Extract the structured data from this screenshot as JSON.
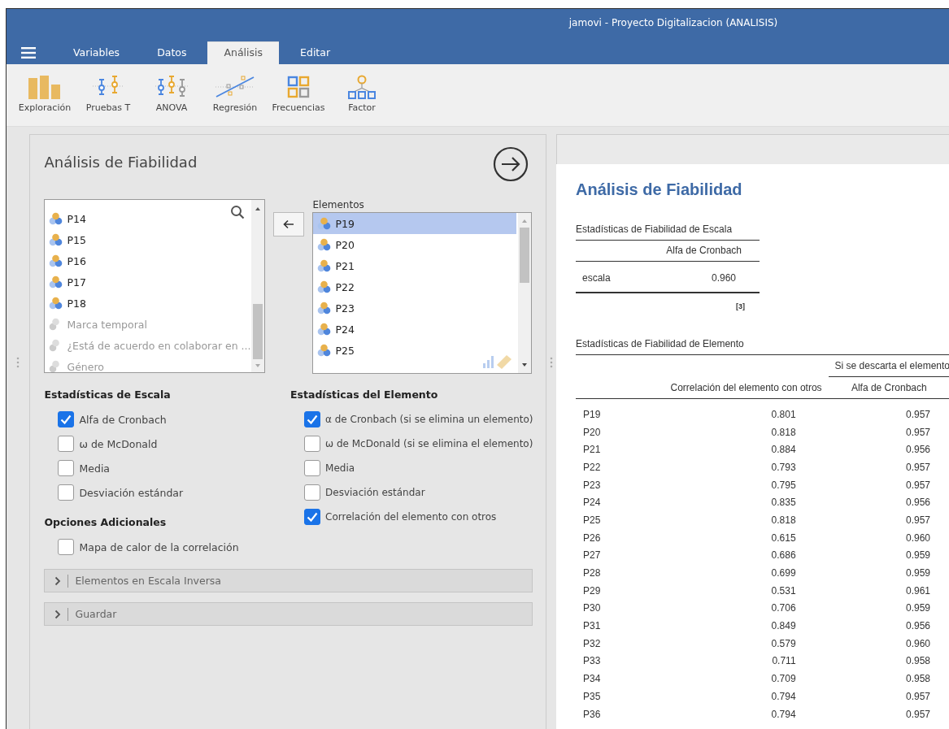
{
  "window": {
    "title": "jamovi - Proyecto Digitalizacion (ANALISIS)"
  },
  "tabs": [
    {
      "label": "Variables",
      "selected": false
    },
    {
      "label": "Datos",
      "selected": false
    },
    {
      "label": "Análisis",
      "selected": true
    },
    {
      "label": "Editar",
      "selected": false
    }
  ],
  "toolbar": [
    {
      "label": "Exploración",
      "kind": "bars"
    },
    {
      "label": "Pruebas T",
      "kind": "ttest"
    },
    {
      "label": "ANOVA",
      "kind": "anova"
    },
    {
      "label": "Regresión",
      "kind": "regression"
    },
    {
      "label": "Frecuencias",
      "kind": "grid"
    },
    {
      "label": "Factor",
      "kind": "tree"
    }
  ],
  "panel": {
    "title": "Análisis de Fiabilidad",
    "variables": [
      {
        "name": "P14",
        "disabled": false
      },
      {
        "name": "P15",
        "disabled": false
      },
      {
        "name": "P16",
        "disabled": false
      },
      {
        "name": "P17",
        "disabled": false
      },
      {
        "name": "P18",
        "disabled": false
      },
      {
        "name": "Marca temporal",
        "disabled": true
      },
      {
        "name": "¿Está de acuerdo en colaborar en ...",
        "disabled": true
      },
      {
        "name": "Género",
        "disabled": true
      }
    ],
    "target": {
      "label": "Elementos",
      "items": [
        {
          "name": "P19",
          "selected": true
        },
        {
          "name": "P20",
          "selected": false
        },
        {
          "name": "P21",
          "selected": false
        },
        {
          "name": "P22",
          "selected": false
        },
        {
          "name": "P23",
          "selected": false
        },
        {
          "name": "P24",
          "selected": false
        },
        {
          "name": "P25",
          "selected": false
        }
      ]
    },
    "scale_stats": {
      "heading": "Estadísticas de Escala",
      "options": [
        {
          "label": "Alfa de Cronbach",
          "checked": true
        },
        {
          "label": "ω de McDonald",
          "checked": false
        },
        {
          "label": "Media",
          "checked": false
        },
        {
          "label": "Desviación estándar",
          "checked": false
        }
      ]
    },
    "additional": {
      "heading": "Opciones Adicionales",
      "options": [
        {
          "label": "Mapa de calor de la correlación",
          "checked": false
        }
      ]
    },
    "item_stats": {
      "heading": "Estadísticas del Elemento",
      "options": [
        {
          "label": "α de Cronbach (si se elimina un elemento)",
          "checked": true
        },
        {
          "label": "ω de McDonald (si se elimina el elemento)",
          "checked": false
        },
        {
          "label": "Media",
          "checked": false
        },
        {
          "label": "Desviación estándar",
          "checked": false
        },
        {
          "label": "Correlación del elemento con otros",
          "checked": true
        }
      ]
    },
    "collapsibles": [
      {
        "label": "Elementos en Escala Inversa",
        "expanded": false
      },
      {
        "label": "Guardar",
        "expanded": false
      }
    ]
  },
  "results": {
    "title": "Análisis de Fiabilidad",
    "scale_table": {
      "title": "Estadísticas de Fiabilidad de Escala",
      "column": "Alfa de Cronbach",
      "row_label": "escala",
      "value": "0.960",
      "footnote": "[3]"
    },
    "item_table": {
      "title": "Estadísticas de Fiabilidad de Elemento",
      "group_header": "Si se descarta el elemento",
      "columns": [
        "",
        "Correlación del elemento con otros",
        "Alfa de Cronbach"
      ],
      "rows": [
        [
          "P19",
          "0.801",
          "0.957"
        ],
        [
          "P20",
          "0.818",
          "0.957"
        ],
        [
          "P21",
          "0.884",
          "0.956"
        ],
        [
          "P22",
          "0.793",
          "0.957"
        ],
        [
          "P23",
          "0.795",
          "0.957"
        ],
        [
          "P24",
          "0.835",
          "0.956"
        ],
        [
          "P25",
          "0.818",
          "0.957"
        ],
        [
          "P26",
          "0.615",
          "0.960"
        ],
        [
          "P27",
          "0.686",
          "0.959"
        ],
        [
          "P28",
          "0.699",
          "0.959"
        ],
        [
          "P29",
          "0.531",
          "0.961"
        ],
        [
          "P30",
          "0.706",
          "0.959"
        ],
        [
          "P31",
          "0.849",
          "0.956"
        ],
        [
          "P32",
          "0.579",
          "0.960"
        ],
        [
          "P33",
          "0.711",
          "0.958"
        ],
        [
          "P34",
          "0.709",
          "0.958"
        ],
        [
          "P35",
          "0.794",
          "0.957"
        ],
        [
          "P36",
          "0.794",
          "0.957"
        ]
      ]
    }
  }
}
